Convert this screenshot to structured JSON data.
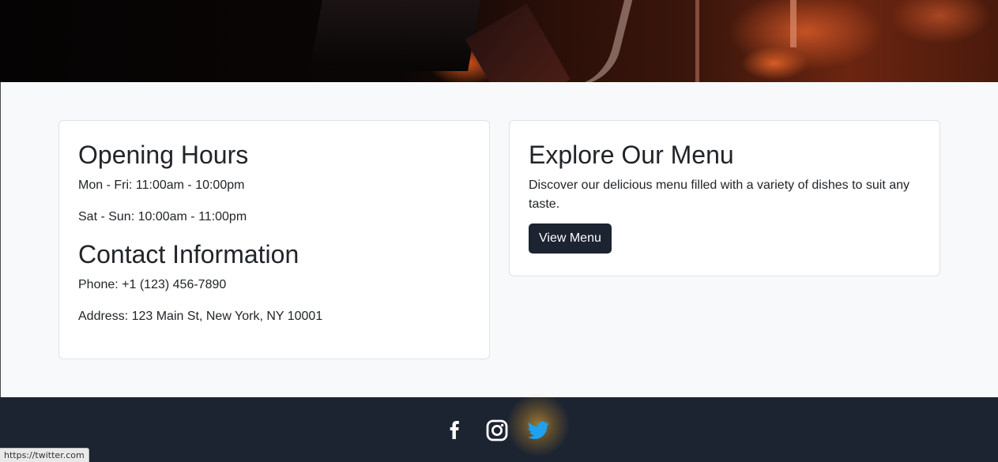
{
  "hours": {
    "title": "Opening Hours",
    "weekdays": "Mon - Fri: 11:00am - 10:00pm",
    "weekend": "Sat - Sun: 10:00am - 11:00pm"
  },
  "contact": {
    "title": "Contact Information",
    "phone": "Phone: +1 (123) 456-7890",
    "address": "Address: 123 Main St, New York, NY 10001"
  },
  "menu": {
    "title": "Explore Our Menu",
    "description": "Discover our delicious menu filled with a variety of dishes to suit any taste.",
    "button_label": "View Menu"
  },
  "footer": {
    "social": [
      "facebook-icon",
      "instagram-icon",
      "twitter-icon"
    ]
  },
  "status_bar": {
    "url": "https://twitter.com"
  },
  "colors": {
    "footer_bg": "#1c2331",
    "button_bg": "#1c2331",
    "twitter_blue": "#1da1f2",
    "page_bg": "#f8f9fa"
  }
}
